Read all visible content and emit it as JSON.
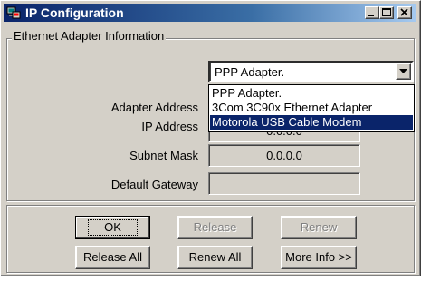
{
  "window": {
    "title": "IP Configuration",
    "icon": "network-computer-icon"
  },
  "colors": {
    "titlebar_start": "#0a246a",
    "titlebar_end": "#a6caf0",
    "face": "#d4d0c8",
    "selection": "#0a246a"
  },
  "adapter_group": {
    "label": "Ethernet  Adapter Information",
    "selected_adapter": "PPP Adapter.",
    "dropdown_options": [
      "PPP Adapter.",
      "3Com 3C90x Ethernet Adapter",
      "Motorola USB Cable Modem"
    ],
    "highlighted_option": "Motorola USB Cable Modem"
  },
  "fields": {
    "adapter_address": {
      "label": "Adapter Address",
      "value": ""
    },
    "ip_address": {
      "label": "IP Address",
      "value": "0.0.0.0"
    },
    "subnet_mask": {
      "label": "Subnet Mask",
      "value": "0.0.0.0"
    },
    "default_gateway": {
      "label": "Default Gateway",
      "value": ""
    }
  },
  "buttons": {
    "ok": "OK",
    "release": "Release",
    "renew": "Renew",
    "release_all": "Release All",
    "renew_all": "Renew All",
    "more_info": "More Info >>"
  }
}
